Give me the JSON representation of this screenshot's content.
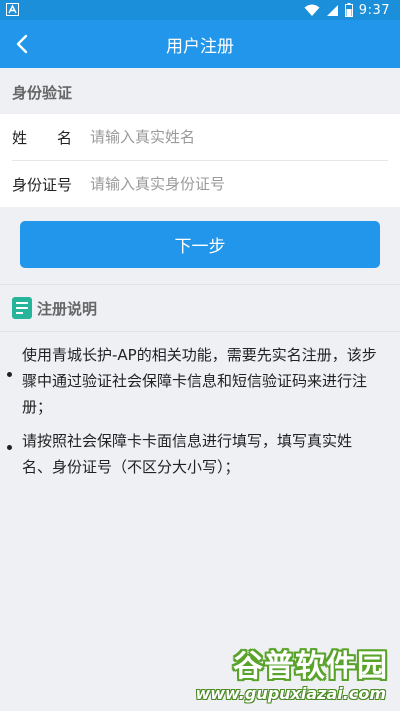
{
  "status_bar": {
    "left_icon": "a-notification-icon",
    "icons": [
      "wifi-icon",
      "signal-icon",
      "battery-icon"
    ],
    "time": "9:37"
  },
  "appbar": {
    "back_icon": "chevron-left-icon",
    "title": "用户注册"
  },
  "section": {
    "title": "身份验证"
  },
  "form": {
    "name": {
      "label_first": "姓",
      "label_last": "名",
      "placeholder": "请输入真实姓名",
      "value": ""
    },
    "id_number": {
      "label": "身份证号",
      "placeholder": "请输入真实身份证号",
      "value": ""
    }
  },
  "next_button": {
    "label": "下一步"
  },
  "notes": {
    "icon": "document-icon",
    "title": "注册说明",
    "items": [
      "使用青城长护-AP的相关功能，需要先实名注册，该步骤中通过验证社会保障卡信息和短信验证码来进行注册；",
      "请按照社会保障卡卡面信息进行填写，填写真实姓名、身份证号（不区分大小写）；"
    ]
  },
  "watermark": {
    "text": "谷普软件园",
    "url": "www.gupuxiazai.com"
  },
  "colors": {
    "primary": "#2196ea",
    "statusbar": "#1b8fd9",
    "background": "#eff0f4",
    "note_icon": "#26b59a"
  }
}
